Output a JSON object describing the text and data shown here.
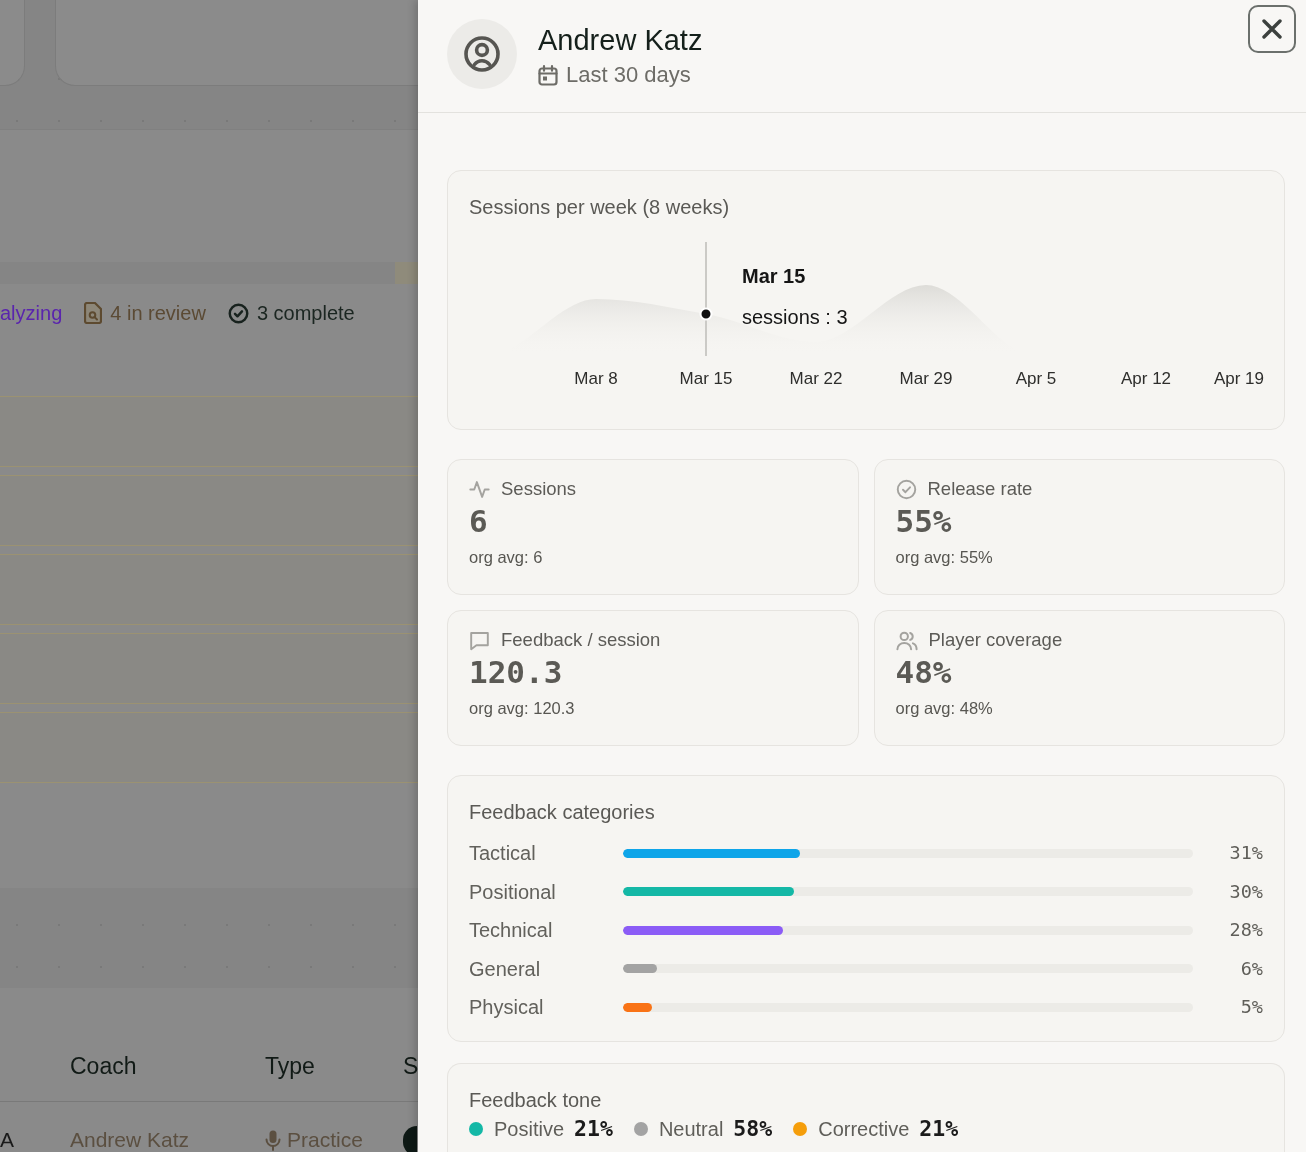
{
  "background_page": {
    "status_summary": [
      {
        "kind": "analyzing",
        "label": "alyzing"
      },
      {
        "kind": "in_review",
        "label": "4 in review"
      },
      {
        "kind": "complete",
        "label": "3 complete"
      }
    ],
    "table": {
      "columns": [
        "Coach",
        "Type",
        "S"
      ],
      "rows": [
        {
          "column_1": "A",
          "coach": "Andrew Katz",
          "type": "Practice"
        }
      ]
    }
  },
  "panel": {
    "header": {
      "name": "Andrew Katz",
      "period": "Last 30 days"
    },
    "sessions_chart": {
      "title": "Sessions per week (8 weeks)",
      "x_labels": [
        "Mar 8",
        "Mar 15",
        "Mar 22",
        "Mar 29",
        "Apr 5",
        "Apr 12",
        "Apr 19"
      ],
      "tooltip": {
        "title": "Mar 15",
        "text": "sessions : 3"
      }
    },
    "stats": [
      {
        "kind": "sessions",
        "label": "Sessions",
        "value": "6",
        "note": "org avg: 6"
      },
      {
        "kind": "release_rate",
        "label": "Release rate",
        "value": "55%",
        "note": "org avg: 55%"
      },
      {
        "kind": "feedback",
        "label": "Feedback / session",
        "value": "120.3",
        "note": "org avg: 120.3"
      },
      {
        "kind": "coverage",
        "label": "Player coverage",
        "value": "48%",
        "note": "org avg: 48%"
      }
    ],
    "categories": {
      "title": "Feedback categories",
      "items": [
        {
          "label": "Tactical",
          "level": 0.31,
          "reading": "31%",
          "color": "#0ea5e9"
        },
        {
          "label": "Positional",
          "level": 0.3,
          "reading": "30%",
          "color": "#14b8a6"
        },
        {
          "label": "Technical",
          "level": 0.28,
          "reading": "28%",
          "color": "#8b5cf6"
        },
        {
          "label": "General",
          "level": 0.06,
          "reading": "6%",
          "color": "#a3a3a3"
        },
        {
          "label": "Physical",
          "level": 0.05,
          "reading": "5%",
          "color": "#f97316"
        }
      ]
    },
    "tone": {
      "title": "Feedback tone",
      "items": [
        {
          "label": "Positive",
          "value": "21%",
          "color": "#14b8a6"
        },
        {
          "label": "Neutral",
          "value": "58%",
          "color": "#a3a3a3"
        },
        {
          "label": "Corrective",
          "value": "21%",
          "color": "#f59e0b"
        }
      ]
    }
  }
}
